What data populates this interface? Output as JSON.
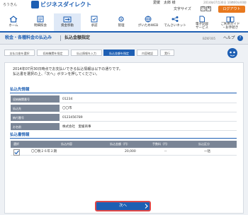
{
  "header": {
    "logo_badge": "ろうきん",
    "logo_text": "ビジネスダイレクト",
    "user_name": "愛媛　太郎 様",
    "last_login": "2014年07月30日 10時00分00秒",
    "font_size_label": "文字サイズ",
    "font_size_small": "小",
    "font_size_large": "大",
    "logout_label": "ログアウト"
  },
  "nav": [
    {
      "label": "ホーム",
      "icon": "home-icon"
    },
    {
      "label": "明細照会",
      "icon": "list-icon"
    },
    {
      "label": "資金移動",
      "icon": "transfer-icon"
    },
    {
      "label": "承認",
      "icon": "approval-icon"
    },
    {
      "label": "管理",
      "icon": "gear-icon"
    },
    {
      "label": "がいためWEB",
      "icon": "globe-icon"
    },
    {
      "label": "でんさいネット",
      "icon": "network-icon"
    },
    {
      "label": "電子記録\nサービス",
      "icon": "document-icon"
    },
    {
      "label": "ご利用ガイド\n・お手続き",
      "icon": "guide-icon"
    }
  ],
  "page": {
    "title": "税金・各種料金の払込み",
    "subtitle": "払込金額指定",
    "screen_id": "BZKF005",
    "help_label": "ヘルプ",
    "help_icon": "?"
  },
  "steps": [
    {
      "label": "支払口座を選択",
      "active": false
    },
    {
      "label": "収納機関を指定",
      "active": false
    },
    {
      "label": "払込情報を入力",
      "active": false
    },
    {
      "label": "払込金額を指定",
      "active": true
    },
    {
      "label": "内容確認",
      "active": false
    },
    {
      "label": "実行",
      "active": false
    }
  ],
  "notice": {
    "line1": "2014年07月30日時点でお支払いできる払込情報は以下の通りです。",
    "line2": "払込書を選択の上、「次へ」ボタンを押してください。"
  },
  "payee_section": {
    "title": "払込先情報",
    "rows": [
      {
        "key": "収納機関番号",
        "value": "01234"
      },
      {
        "key": "払込先",
        "value": "〇〇市"
      },
      {
        "key": "納付番号",
        "value": "0123456789"
      },
      {
        "key": "お名前",
        "value": "株式会社　愛媛商事"
      }
    ]
  },
  "bill_section": {
    "title": "払込書情報",
    "columns": [
      "選択",
      "払込内容",
      "払込金額（円）",
      "手数料（円）",
      "払込区分"
    ],
    "rows": [
      {
        "selected": true,
        "content": "〇〇税２６年２期",
        "amount": "20,000",
        "fee": "--",
        "category": "一括"
      }
    ]
  },
  "next_label": "次へ",
  "colors": {
    "primary": "#1e5fb3",
    "logout": "#e8791f",
    "highlight_border": "#e04848",
    "table_header": "#7a8596"
  }
}
